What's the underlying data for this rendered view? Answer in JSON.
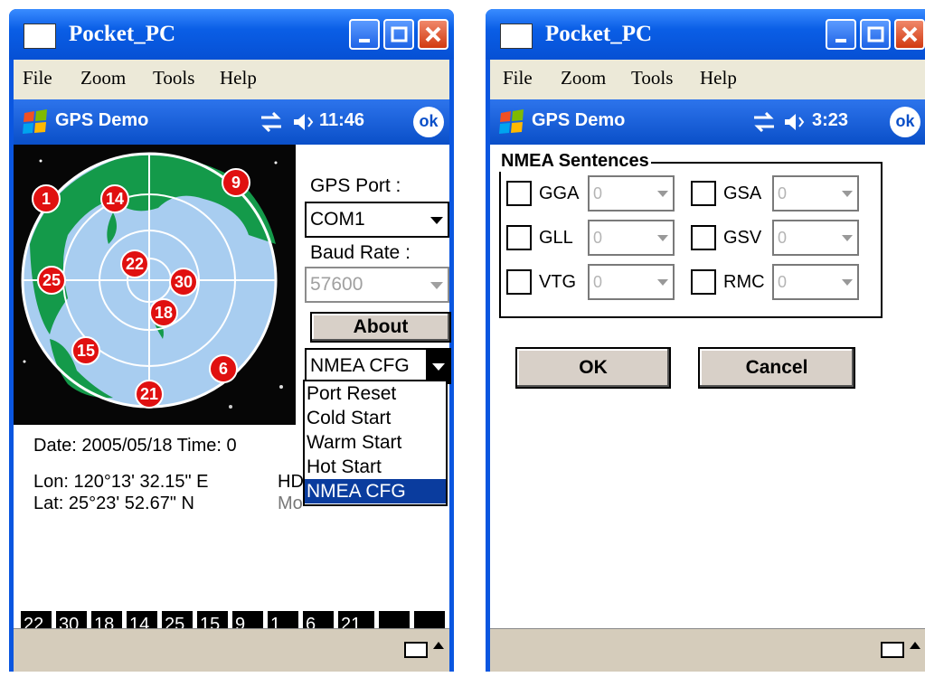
{
  "left_window": {
    "title": "Pocket_PC",
    "menu": [
      "File",
      "Zoom",
      "Tools",
      "Help"
    ],
    "taskbar": {
      "app_title": "GPS Demo",
      "time": "11:46",
      "ok_label": "ok"
    },
    "gps_port": {
      "label": "GPS Port :",
      "value": "COM1"
    },
    "baud_rate": {
      "label": "Baud Rate :",
      "value": "57600"
    },
    "about_button": "About",
    "command_combo": "NMEA CFG",
    "dropdown_options": [
      "Port Reset",
      "Cold Start",
      "Warm Start",
      "Hot Start",
      "NMEA CFG"
    ],
    "dropdown_selected": "NMEA CFG",
    "satellites_on_map": [
      "1",
      "14",
      "9",
      "22",
      "25",
      "30",
      "18",
      "15",
      "6",
      "21"
    ],
    "date_line": "Date: 2005/05/18  Time: 0",
    "lon_line": "Lon:  120°13' 32.15\" E",
    "lat_line": "Lat:   25°23' 52.67\" N",
    "hd_partial": "HD",
    "mode_partial": "Mo",
    "sat_bar": [
      "22",
      "30",
      "18",
      "14",
      "25",
      "15",
      "9",
      "1",
      "6",
      "21",
      "",
      ""
    ]
  },
  "right_window": {
    "title": "Pocket_PC",
    "menu": [
      "File",
      "Zoom",
      "Tools",
      "Help"
    ],
    "taskbar": {
      "app_title": "GPS Demo",
      "time": "3:23",
      "ok_label": "ok"
    },
    "group_title": "NMEA Sentences",
    "sentences": [
      {
        "name": "GGA",
        "value": "0"
      },
      {
        "name": "GSA",
        "value": "0"
      },
      {
        "name": "GLL",
        "value": "0"
      },
      {
        "name": "GSV",
        "value": "0"
      },
      {
        "name": "VTG",
        "value": "0"
      },
      {
        "name": "RMC",
        "value": "0"
      }
    ],
    "ok_button": "OK",
    "cancel_button": "Cancel"
  },
  "colors": {
    "titlebar": "#0a5ee6",
    "taskbar": "#0a4fc8",
    "globe_ocean": "#a8cdf0",
    "globe_land": "#149a4a",
    "satellite": "#e01010",
    "selection": "#0a3c9e"
  }
}
